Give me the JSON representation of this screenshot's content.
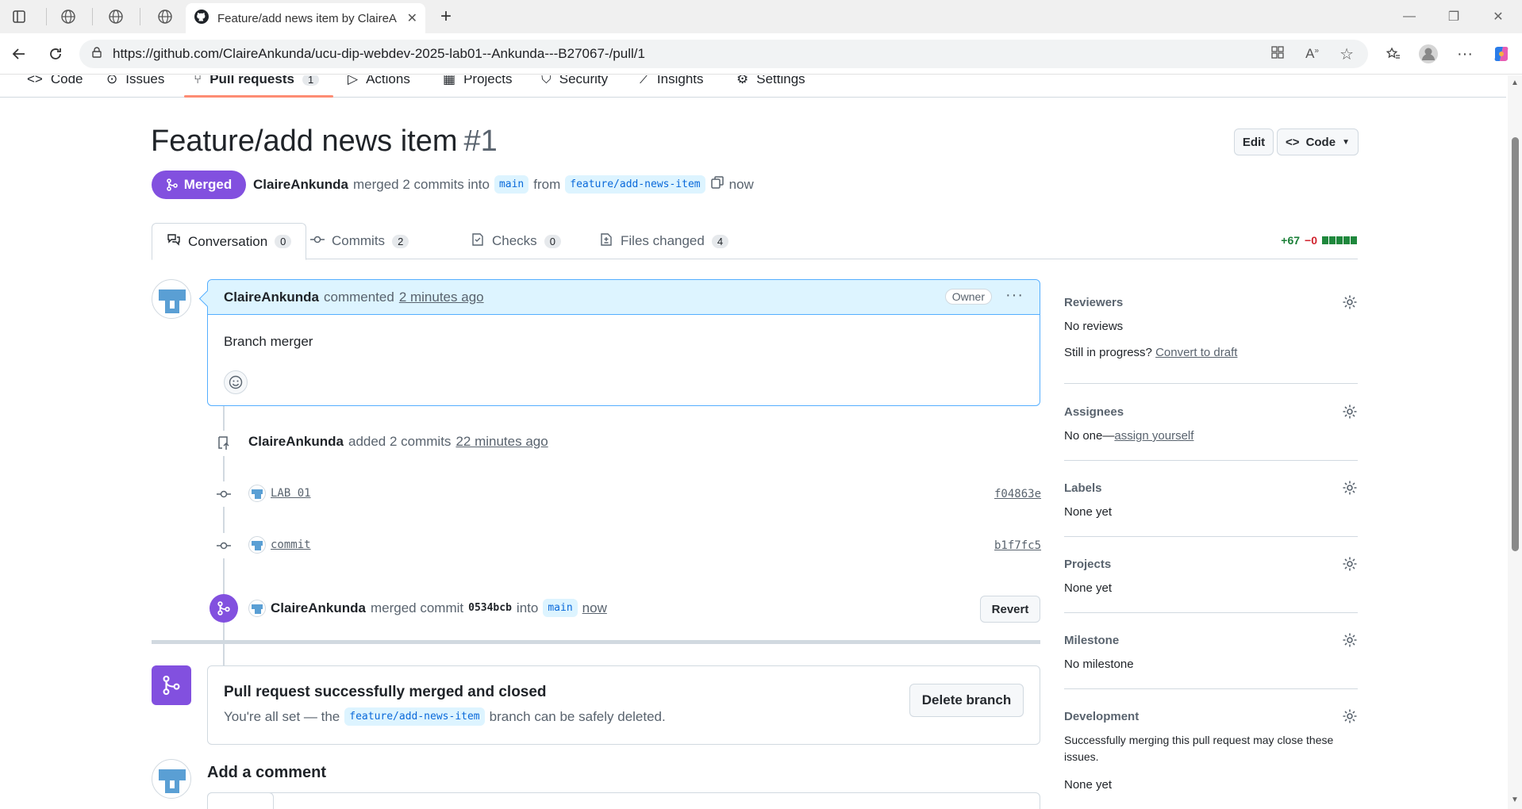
{
  "browser": {
    "tab_title": "Feature/add news item by ClaireA",
    "url": "https://github.com/ClaireAnkunda/ucu-dip-webdev-2025-lab01--Ankunda---B27067-/pull/1"
  },
  "repo_nav": {
    "code": "Code",
    "issues": "Issues",
    "pull_requests": "Pull requests",
    "pull_requests_count": "1",
    "actions": "Actions",
    "projects": "Projects",
    "security": "Security",
    "insights": "Insights",
    "settings": "Settings"
  },
  "pr": {
    "title": "Feature/add news item",
    "number": "#1",
    "edit_label": "Edit",
    "code_label": "Code",
    "state": "Merged",
    "author": "ClaireAnkunda",
    "merged_text": "merged 2 commits into",
    "base_branch": "main",
    "from_text": "from",
    "head_branch": "feature/add-news-item",
    "time": "now"
  },
  "tabs": {
    "conversation": "Conversation",
    "conversation_count": "0",
    "commits": "Commits",
    "commits_count": "2",
    "checks": "Checks",
    "checks_count": "0",
    "files_changed": "Files changed",
    "files_changed_count": "4",
    "additions": "+67",
    "deletions": "−0"
  },
  "comment": {
    "author": "ClaireAnkunda",
    "action": "commented",
    "time": "2 minutes ago",
    "role": "Owner",
    "body": "Branch merger"
  },
  "timeline": {
    "commits_event": {
      "author": "ClaireAnkunda",
      "text": "added 2 commits",
      "time": "22 minutes ago"
    },
    "commits": [
      {
        "message": "LAB 01",
        "sha": "f04863e"
      },
      {
        "message": "commit",
        "sha": "b1f7fc5"
      }
    ],
    "merge_event": {
      "author": "ClaireAnkunda",
      "text": "merged commit",
      "sha": "0534bcb",
      "into": "into",
      "branch": "main",
      "time": "now",
      "revert_label": "Revert"
    }
  },
  "merged_box": {
    "title": "Pull request successfully merged and closed",
    "text_before": "You're all set — the",
    "branch": "feature/add-news-item",
    "text_after": "branch can be safely deleted.",
    "delete_label": "Delete branch"
  },
  "add_comment": {
    "title": "Add a comment"
  },
  "sidebar": {
    "reviewers": {
      "heading": "Reviewers",
      "value": "No reviews",
      "hint": "Still in progress?",
      "hint_link": "Convert to draft"
    },
    "assignees": {
      "heading": "Assignees",
      "value": "No one—",
      "link": "assign yourself"
    },
    "labels": {
      "heading": "Labels",
      "value": "None yet"
    },
    "projects": {
      "heading": "Projects",
      "value": "None yet"
    },
    "milestone": {
      "heading": "Milestone",
      "value": "No milestone"
    },
    "development": {
      "heading": "Development",
      "text": "Successfully merging this pull request may close these issues.",
      "value": "None yet"
    }
  },
  "colors": {
    "merged_purple": "#8250df",
    "link_blue": "#0969da",
    "additions_green": "#1a7f37",
    "deletions_red": "#d1242f"
  }
}
